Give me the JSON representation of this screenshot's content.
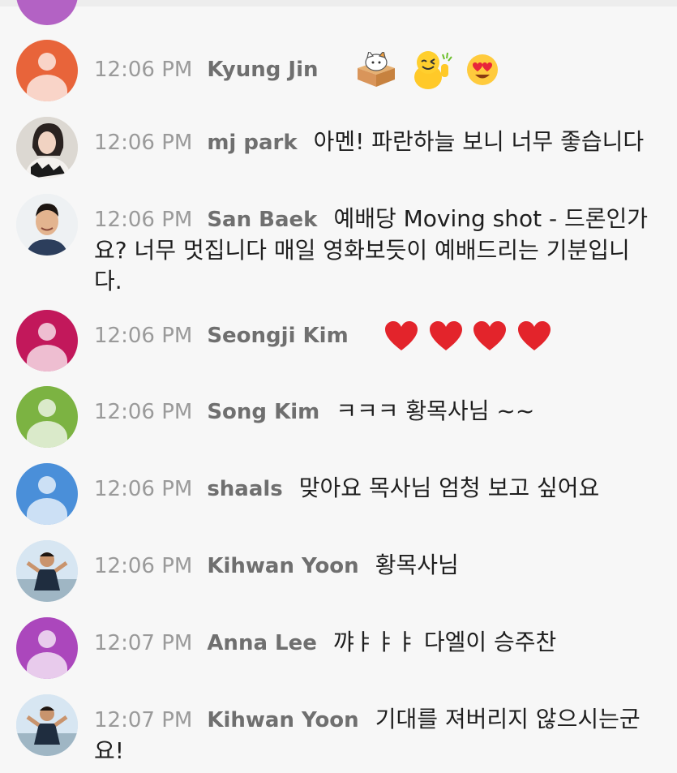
{
  "colors": {
    "background": "#f7f7f7",
    "time": "#9a9a9a",
    "author": "#6f6f6f",
    "text": "#1e1e1e"
  },
  "messages": [
    {
      "time": "12:06 PM",
      "author": "Kyung Jin",
      "avatar": {
        "type": "default",
        "color": "#e8643a"
      },
      "text": "",
      "emojis": [
        "cat-in-box-emoji",
        "yellow-thumbs-up-emoji",
        "heart-eyes-emoji"
      ]
    },
    {
      "time": "12:06 PM",
      "author": "mj park",
      "avatar": {
        "type": "photo",
        "description": "woman-photo"
      },
      "text": "아멘! 파란하늘 보니 너무 좋습니다"
    },
    {
      "time": "12:06 PM",
      "author": "San Baek",
      "avatar": {
        "type": "photo",
        "description": "man-photo"
      },
      "text": "예배당 Moving shot - 드론인가요? 너무 멋집니다 매일 영화보듯이 예배드리는 기분입니다."
    },
    {
      "time": "12:06 PM",
      "author": "Seongji Kim",
      "avatar": {
        "type": "default",
        "color": "#c2185b"
      },
      "text": "",
      "emojis": [
        "red-heart-emoji",
        "red-heart-emoji",
        "red-heart-emoji",
        "red-heart-emoji"
      ]
    },
    {
      "time": "12:06 PM",
      "author": "Song Kim",
      "avatar": {
        "type": "default",
        "color": "#7cb342"
      },
      "text": "ㅋㅋㅋ 황목사님 ~~"
    },
    {
      "time": "12:06 PM",
      "author": "shaals",
      "avatar": {
        "type": "default",
        "color": "#4a8fd9"
      },
      "text": "맞아요 목사님 엄청 보고 싶어요"
    },
    {
      "time": "12:06 PM",
      "author": "Kihwan Yoon",
      "avatar": {
        "type": "photo",
        "description": "man-outdoor-photo"
      },
      "text": "황목사님"
    },
    {
      "time": "12:07 PM",
      "author": "Anna Lee",
      "avatar": {
        "type": "default",
        "color": "#ab47bc"
      },
      "text": "꺄ㅑㅑㅑ 다엘이 승주찬"
    },
    {
      "time": "12:07 PM",
      "author": "Kihwan Yoon",
      "avatar": {
        "type": "photo",
        "description": "man-outdoor-photo"
      },
      "text": "기대를 져버리지 않으시는군요!"
    }
  ]
}
